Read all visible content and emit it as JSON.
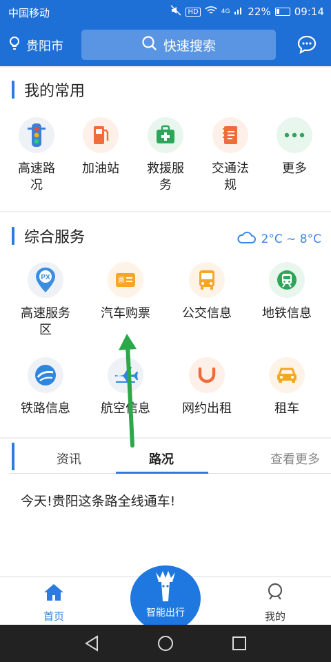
{
  "status_bar": {
    "carrier": "中国移动",
    "hd": "HD",
    "network": "4G",
    "battery": "22%",
    "time": "09:14"
  },
  "header": {
    "city": "贵阳市",
    "search_placeholder": "快速搜索"
  },
  "favorites": {
    "title": "我的常用",
    "items": [
      {
        "label": "高速路况",
        "icon": "traffic-light-icon"
      },
      {
        "label": "加油站",
        "icon": "gas-station-icon"
      },
      {
        "label": "救援服务",
        "icon": "first-aid-kit-icon"
      },
      {
        "label": "交通法规",
        "icon": "law-book-icon"
      },
      {
        "label": "更多",
        "icon": "more-dots-icon"
      }
    ]
  },
  "services": {
    "title": "综合服务",
    "weather": "2°C ~ 8°C",
    "items": [
      {
        "label": "高速服务区",
        "icon": "service-area-pin-icon",
        "icon_text": "PX"
      },
      {
        "label": "汽车购票",
        "icon": "bus-ticket-icon",
        "icon_text": "票"
      },
      {
        "label": "公交信息",
        "icon": "bus-icon"
      },
      {
        "label": "地铁信息",
        "icon": "metro-icon"
      },
      {
        "label": "铁路信息",
        "icon": "railway-icon"
      },
      {
        "label": "航空信息",
        "icon": "airplane-icon"
      },
      {
        "label": "网约出租",
        "icon": "ride-hailing-icon"
      },
      {
        "label": "租车",
        "icon": "rental-car-icon"
      }
    ]
  },
  "news": {
    "tabs": [
      "资讯",
      "路况"
    ],
    "active_tab": "路况",
    "see_more": "查看更多",
    "headline": "今天!贵阳这条路全线通车!"
  },
  "bottom_nav": {
    "home": "首页",
    "center": "智能出行",
    "mine": "我的"
  },
  "colors": {
    "brand_blue": "#1e6fd6",
    "accent_blue": "#2b7be0",
    "arrow_green": "#2aa84a"
  }
}
